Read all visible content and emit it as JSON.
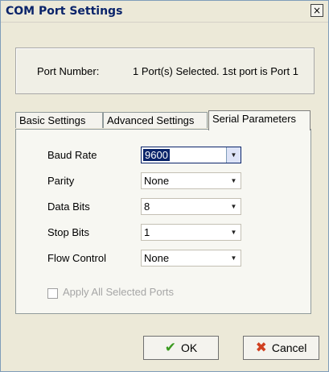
{
  "window": {
    "title": "COM Port Settings",
    "close_glyph": "×"
  },
  "port": {
    "label": "Port Number:",
    "value": "1 Port(s) Selected. 1st port is Port 1"
  },
  "tabs": [
    {
      "label": "Basic Settings",
      "active": false
    },
    {
      "label": "Advanced Settings",
      "active": false
    },
    {
      "label": "Serial Parameters",
      "active": true
    }
  ],
  "fields": [
    {
      "label": "Baud Rate",
      "value": "9600"
    },
    {
      "label": "Parity",
      "value": "None"
    },
    {
      "label": "Data Bits",
      "value": "8"
    },
    {
      "label": "Stop Bits",
      "value": "1"
    },
    {
      "label": "Flow Control",
      "value": "None"
    }
  ],
  "apply_all": {
    "label": "Apply All Selected Ports",
    "checked": false,
    "disabled": true
  },
  "buttons": {
    "ok": "OK",
    "cancel": "Cancel"
  },
  "icons": {
    "ok": "checkmark-icon",
    "cancel": "x-icon",
    "dropdown": "chevron-down-icon"
  },
  "colors": {
    "title_text": "#0a246a",
    "selection": "#0a246a",
    "ok_icon": "#3a9a1f",
    "cancel_icon": "#d04020"
  }
}
